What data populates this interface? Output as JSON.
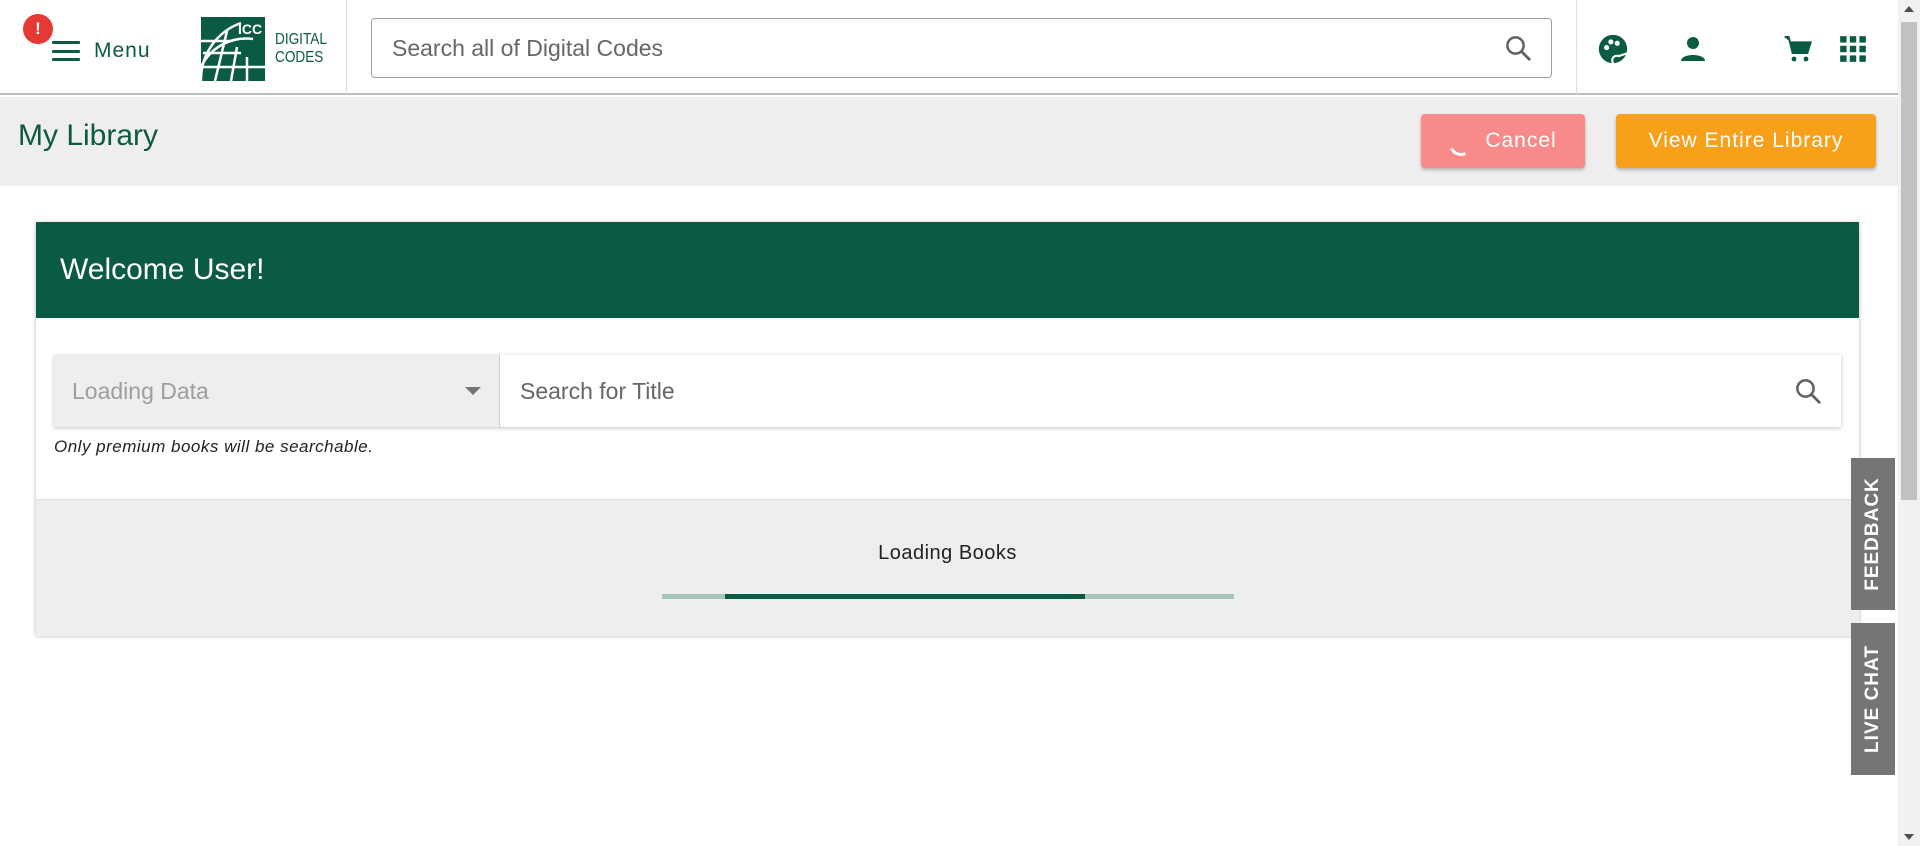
{
  "header": {
    "alert_badge": "!",
    "menu_label": "Menu",
    "logo_line1": "ICC",
    "logo_line2": "DIGITAL",
    "logo_line3": "CODES",
    "search_placeholder": "Search all of Digital Codes",
    "icons": [
      "search-icon",
      "palette-icon",
      "user-icon",
      "cart-icon",
      "apps-grid-icon"
    ]
  },
  "subheader": {
    "title": "My Library",
    "cancel_label": "Cancel",
    "view_library_label": "View Entire Library"
  },
  "card": {
    "welcome": "Welcome User!",
    "select_value": "Loading Data",
    "title_search_placeholder": "Search for Title",
    "note": "Only premium books will be searchable.",
    "loading_text": "Loading Books",
    "progress": {
      "start_fraction": 0.11,
      "end_fraction": 0.74
    }
  },
  "side_tabs": {
    "feedback": "FEEDBACK",
    "live_chat": "LIVE CHAT"
  },
  "colors": {
    "brand_green": "#0b5a43",
    "cancel_red": "#f88a8a",
    "view_orange": "#f9a01b",
    "alert_red": "#e53935",
    "side_tab_gray": "#757575"
  }
}
